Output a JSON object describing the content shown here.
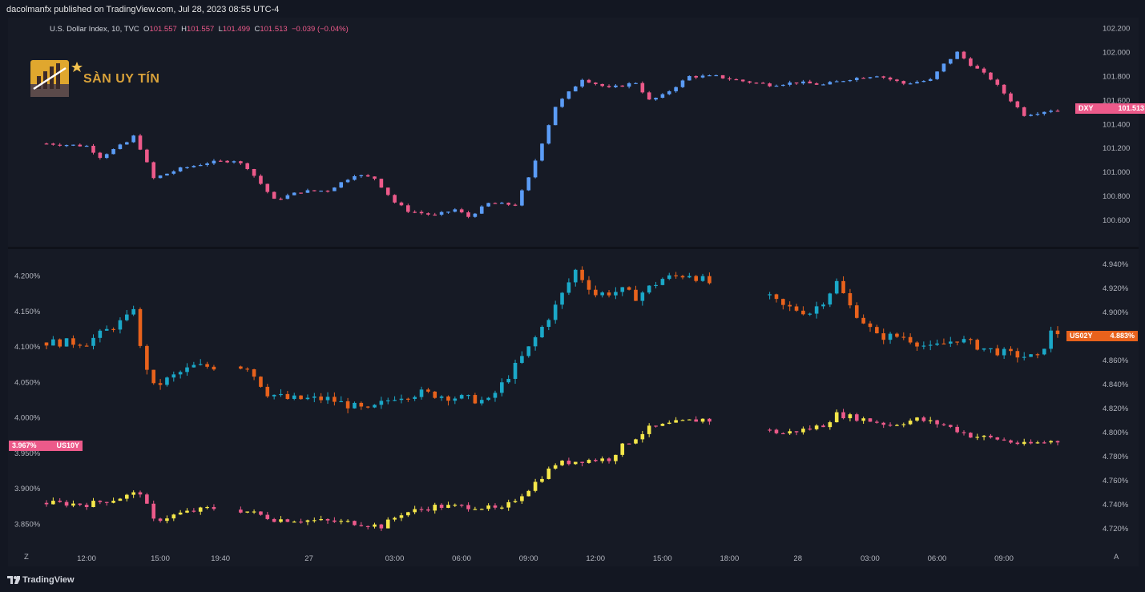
{
  "header": {
    "published": "dacolmanfx published on TradingView.com, Jul 28, 2023 08:55 UTC-4"
  },
  "legend": {
    "symbol": "U.S. Dollar Index, 10, TVC",
    "o_label": "O",
    "o": "101.557",
    "h_label": "H",
    "h": "101.557",
    "l_label": "L",
    "l": "101.499",
    "c_label": "C",
    "c": "101.513",
    "change": "−0.039 (−0.04%)"
  },
  "logo": {
    "text": "SÀN UY TÍN"
  },
  "footer": {
    "brand": "TradingView",
    "left_button": "Z",
    "right_button": "A"
  },
  "colors": {
    "bg": "#161a25",
    "dxy_up": "#5b9cf6",
    "dxy_down": "#ec5a8a",
    "us02y_up": "#1ba8c8",
    "us02y_down": "#e8621c",
    "us10y_up": "#f5e74a",
    "us10y_down": "#ec5a8a"
  },
  "chart_data": [
    {
      "type": "candlestick",
      "name": "DXY",
      "axis": "right",
      "ylim": [
        100.5,
        102.25
      ],
      "ticks": [
        "102.200",
        "102.000",
        "101.800",
        "101.600",
        "101.400",
        "101.200",
        "101.000",
        "100.800",
        "100.600"
      ],
      "tick_values": [
        102.2,
        102.0,
        101.8,
        101.6,
        101.4,
        101.2,
        101.0,
        100.8,
        100.6
      ],
      "last_value": "101.513",
      "label": "DXY",
      "path": [
        [
          0,
          101.24
        ],
        [
          6,
          101.22
        ],
        [
          8,
          101.13
        ],
        [
          12,
          101.25
        ],
        [
          13,
          101.3
        ],
        [
          14,
          101.2
        ],
        [
          16,
          100.95
        ],
        [
          20,
          101.03
        ],
        [
          24,
          101.08
        ],
        [
          28,
          101.1
        ],
        [
          30,
          101.04
        ],
        [
          34,
          100.77
        ],
        [
          38,
          100.84
        ],
        [
          42,
          100.85
        ],
        [
          46,
          100.98
        ],
        [
          49,
          100.95
        ],
        [
          52,
          100.75
        ],
        [
          54,
          100.68
        ],
        [
          58,
          100.64
        ],
        [
          61,
          100.69
        ],
        [
          63,
          100.63
        ],
        [
          66,
          100.74
        ],
        [
          70,
          100.73
        ],
        [
          72,
          100.95
        ],
        [
          76,
          101.55
        ],
        [
          80,
          101.78
        ],
        [
          84,
          101.7
        ],
        [
          88,
          101.75
        ],
        [
          90,
          101.6
        ],
        [
          92,
          101.64
        ],
        [
          96,
          101.8
        ],
        [
          100,
          101.8
        ],
        [
          104,
          101.76
        ],
        [
          108,
          101.73
        ],
        [
          112,
          101.75
        ],
        [
          116,
          101.73
        ],
        [
          120,
          101.78
        ],
        [
          124,
          101.81
        ],
        [
          128,
          101.74
        ],
        [
          132,
          101.77
        ],
        [
          134,
          101.9
        ],
        [
          136,
          102.0
        ],
        [
          138,
          101.9
        ],
        [
          141,
          101.78
        ],
        [
          146,
          101.48
        ],
        [
          150,
          101.52
        ],
        [
          151,
          101.513
        ]
      ]
    },
    {
      "type": "candlestick",
      "name": "US02Y",
      "axis": "right",
      "ylim": [
        4.712,
        4.948
      ],
      "ticks": [
        "4.940%",
        "4.920%",
        "4.900%",
        "4.880%",
        "4.860%",
        "4.840%",
        "4.820%",
        "4.800%",
        "4.780%",
        "4.760%",
        "4.740%",
        "4.720%"
      ],
      "tick_values": [
        4.94,
        4.92,
        4.9,
        4.88,
        4.86,
        4.84,
        4.82,
        4.8,
        4.78,
        4.76,
        4.74,
        4.72
      ],
      "last_value": "4.883%",
      "label": "US02Y"
    },
    {
      "type": "candlestick",
      "name": "US10Y",
      "axis": "left",
      "ylim": [
        3.83,
        4.23
      ],
      "ticks": [
        "4.200%",
        "4.150%",
        "4.100%",
        "4.050%",
        "4.000%",
        "3.950%",
        "3.900%",
        "3.850%"
      ],
      "tick_values": [
        4.2,
        4.15,
        4.1,
        4.05,
        4.0,
        3.95,
        3.9,
        3.85
      ],
      "last_value": "3.967%",
      "label": "US10Y"
    }
  ],
  "x_ticks": [
    "12:00",
    "15:00",
    "19:40",
    "27",
    "03:00",
    "06:00",
    "09:00",
    "12:00",
    "15:00",
    "18:00",
    "28",
    "03:00",
    "06:00",
    "09:00"
  ]
}
